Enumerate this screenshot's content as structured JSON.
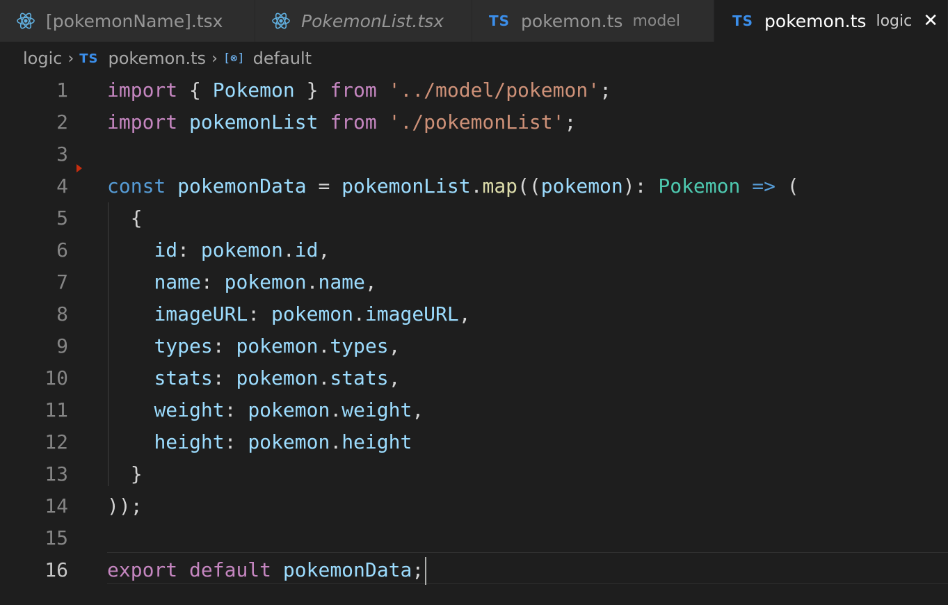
{
  "tabs": [
    {
      "name": "[pokemonName].tsx",
      "desc": "",
      "icon": "react-icon",
      "italic": false,
      "active": false
    },
    {
      "name": "PokemonList.tsx",
      "desc": "",
      "icon": "react-icon",
      "italic": true,
      "active": false
    },
    {
      "name": "pokemon.ts",
      "desc": "model",
      "icon": "ts-icon",
      "italic": false,
      "active": false
    },
    {
      "name": "pokemon.ts",
      "desc": "logic",
      "icon": "ts-icon",
      "italic": false,
      "active": true
    }
  ],
  "ts_label": "TS",
  "close_glyph": "✕",
  "breadcrumb": {
    "folder": "logic",
    "file": "pokemon.ts",
    "symbol": "default",
    "symbol_icon": "[⊗]",
    "sep": "›"
  },
  "line_numbers": [
    "1",
    "2",
    "3",
    "4",
    "5",
    "6",
    "7",
    "8",
    "9",
    "10",
    "11",
    "12",
    "13",
    "14",
    "15",
    "16"
  ],
  "code_lines": [
    [
      [
        "k",
        "import"
      ],
      [
        "p",
        " { "
      ],
      [
        "v",
        "Pokemon"
      ],
      [
        "p",
        " } "
      ],
      [
        "k",
        "from"
      ],
      [
        "p",
        " "
      ],
      [
        "s",
        "'../model/pokemon'"
      ],
      [
        "p",
        ";"
      ]
    ],
    [
      [
        "k",
        "import"
      ],
      [
        "p",
        " "
      ],
      [
        "v",
        "pokemonList"
      ],
      [
        "p",
        " "
      ],
      [
        "k",
        "from"
      ],
      [
        "p",
        " "
      ],
      [
        "s",
        "'./pokemonList'"
      ],
      [
        "p",
        ";"
      ]
    ],
    [],
    [
      [
        "kb",
        "const"
      ],
      [
        "p",
        " "
      ],
      [
        "v",
        "pokemonData"
      ],
      [
        "p",
        " = "
      ],
      [
        "v",
        "pokemonList"
      ],
      [
        "p",
        "."
      ],
      [
        "f",
        "map"
      ],
      [
        "p",
        "(("
      ],
      [
        "v",
        "pokemon"
      ],
      [
        "p",
        "): "
      ],
      [
        "t",
        "Pokemon"
      ],
      [
        "p",
        " "
      ],
      [
        "kb",
        "=>"
      ],
      [
        "p",
        " ("
      ]
    ],
    [
      [
        "p",
        "  {"
      ]
    ],
    [
      [
        "p",
        "    "
      ],
      [
        "v",
        "id"
      ],
      [
        "p",
        ": "
      ],
      [
        "v",
        "pokemon"
      ],
      [
        "p",
        "."
      ],
      [
        "v",
        "id"
      ],
      [
        "p",
        ","
      ]
    ],
    [
      [
        "p",
        "    "
      ],
      [
        "v",
        "name"
      ],
      [
        "p",
        ": "
      ],
      [
        "v",
        "pokemon"
      ],
      [
        "p",
        "."
      ],
      [
        "v",
        "name"
      ],
      [
        "p",
        ","
      ]
    ],
    [
      [
        "p",
        "    "
      ],
      [
        "v",
        "imageURL"
      ],
      [
        "p",
        ": "
      ],
      [
        "v",
        "pokemon"
      ],
      [
        "p",
        "."
      ],
      [
        "v",
        "imageURL"
      ],
      [
        "p",
        ","
      ]
    ],
    [
      [
        "p",
        "    "
      ],
      [
        "v",
        "types"
      ],
      [
        "p",
        ": "
      ],
      [
        "v",
        "pokemon"
      ],
      [
        "p",
        "."
      ],
      [
        "v",
        "types"
      ],
      [
        "p",
        ","
      ]
    ],
    [
      [
        "p",
        "    "
      ],
      [
        "v",
        "stats"
      ],
      [
        "p",
        ": "
      ],
      [
        "v",
        "pokemon"
      ],
      [
        "p",
        "."
      ],
      [
        "v",
        "stats"
      ],
      [
        "p",
        ","
      ]
    ],
    [
      [
        "p",
        "    "
      ],
      [
        "v",
        "weight"
      ],
      [
        "p",
        ": "
      ],
      [
        "v",
        "pokemon"
      ],
      [
        "p",
        "."
      ],
      [
        "v",
        "weight"
      ],
      [
        "p",
        ","
      ]
    ],
    [
      [
        "p",
        "    "
      ],
      [
        "v",
        "height"
      ],
      [
        "p",
        ": "
      ],
      [
        "v",
        "pokemon"
      ],
      [
        "p",
        "."
      ],
      [
        "v",
        "height"
      ]
    ],
    [
      [
        "p",
        "  }"
      ]
    ],
    [
      [
        "p",
        "));"
      ]
    ],
    [],
    [
      [
        "k",
        "export"
      ],
      [
        "p",
        " "
      ],
      [
        "k",
        "default"
      ],
      [
        "p",
        " "
      ],
      [
        "v",
        "pokemonData"
      ],
      [
        "p",
        ";"
      ]
    ]
  ],
  "current_line": 16
}
